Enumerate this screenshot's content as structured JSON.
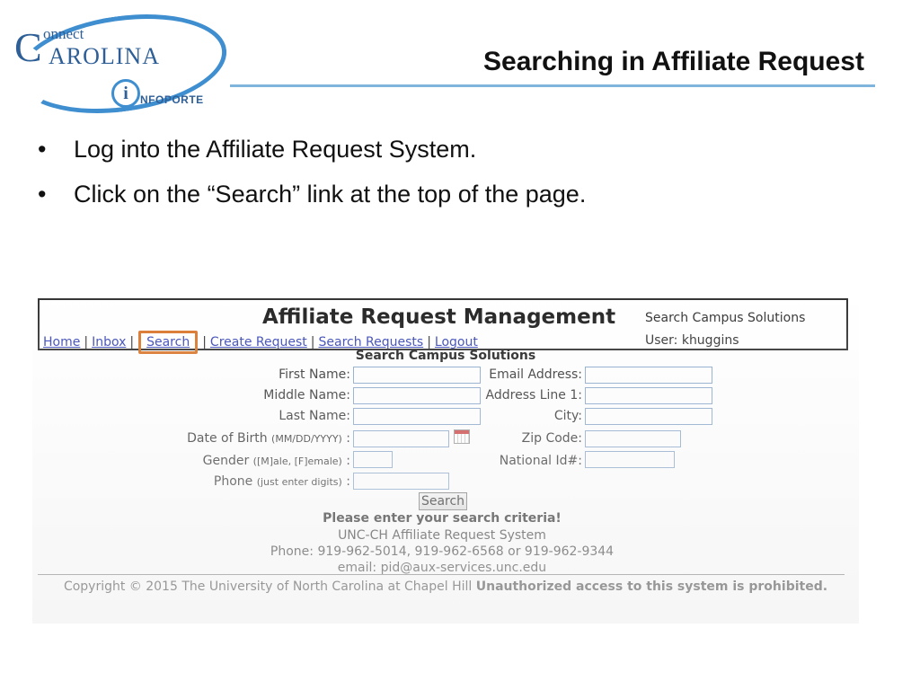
{
  "logo": {
    "connect": "onnect",
    "big_letter": "C",
    "carolina": "AROLINA",
    "i_letter": "i",
    "infoporte": "NFOPORTE"
  },
  "slide_title": "Searching in Affiliate Request",
  "bullets": [
    "Log into the Affiliate Request System.",
    "Click on the “Search” link at the top of the page."
  ],
  "app": {
    "title": "Affiliate Request Management",
    "nav": [
      "Home",
      "Inbox",
      "Search",
      "Create Request",
      "Search Requests",
      "Logout"
    ],
    "nav_separator": "|",
    "context": "Search Campus Solutions",
    "user": "User: khuggins",
    "accent": "#d9762b"
  },
  "form": {
    "title": "Search Campus Solutions",
    "first_name": "First Name:",
    "middle_name": "Middle Name:",
    "last_name": "Last Name:",
    "dob": "Date of Birth",
    "dob_hint": "(MM/DD/YYYY)",
    "gender": "Gender",
    "gender_hint": "([M]ale, [F]emale)",
    "phone": "Phone",
    "phone_hint": "(just enter digits)",
    "colon": ":",
    "email": "Email Address:",
    "address": "Address Line 1:",
    "city": "City:",
    "zip": "Zip Code:",
    "national_id": "National Id#:",
    "search_button": "Search",
    "prompt": "Please enter your search criteria!",
    "system_name": "UNC-CH Affiliate Request System",
    "phones": "Phone: 919-962-5014, 919-962-6568 or 919-962-9344",
    "email_contact": "email: pid@aux-services.unc.edu"
  },
  "footer": {
    "copyright": "Copyright © 2015 The University of North Carolina at Chapel Hill",
    "warning": "Unauthorized access to this system is prohibited."
  }
}
